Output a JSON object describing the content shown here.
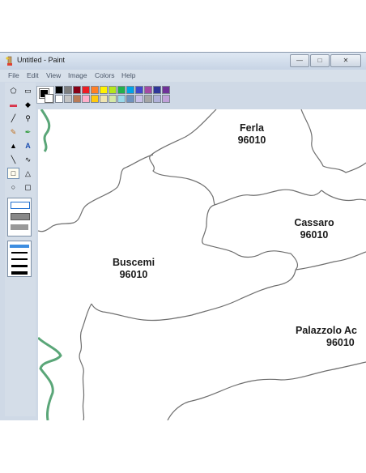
{
  "window": {
    "title": "Untitled - Paint",
    "min": "—",
    "max": "□",
    "close": "✕"
  },
  "menu": [
    "File",
    "Edit",
    "View",
    "Image",
    "Colors",
    "Help"
  ],
  "tools": [
    {
      "name": "free-form-select-icon",
      "glyph": "⬠"
    },
    {
      "name": "rect-select-icon",
      "glyph": "▭"
    },
    {
      "name": "eraser-icon",
      "glyph": "▬"
    },
    {
      "name": "fill-bucket-icon",
      "glyph": "◆"
    },
    {
      "name": "color-picker-icon",
      "glyph": "╱"
    },
    {
      "name": "magnifier-icon",
      "glyph": "⚲"
    },
    {
      "name": "pencil-icon",
      "glyph": "✎"
    },
    {
      "name": "brush-icon",
      "glyph": "✒"
    },
    {
      "name": "airbrush-icon",
      "glyph": "▲"
    },
    {
      "name": "text-tool-icon",
      "glyph": "A"
    },
    {
      "name": "line-tool-icon",
      "glyph": "╲"
    },
    {
      "name": "curve-tool-icon",
      "glyph": "∿"
    },
    {
      "name": "rectangle-tool-icon",
      "glyph": "□"
    },
    {
      "name": "polygon-tool-icon",
      "glyph": "△"
    },
    {
      "name": "ellipse-tool-icon",
      "glyph": "○"
    },
    {
      "name": "rounded-rect-tool-icon",
      "glyph": "▢"
    }
  ],
  "palette": {
    "row1": [
      "#000000",
      "#7f7f7f",
      "#880015",
      "#ed1c24",
      "#ff7f27",
      "#fff200",
      "#b5e61d",
      "#22b14c",
      "#00a2e8",
      "#3f48cc",
      "#a349a4",
      "#2f3699",
      "#6f3198"
    ],
    "row2": [
      "#ffffff",
      "#c3c3c3",
      "#b97a57",
      "#ffaec9",
      "#ffc90e",
      "#efe4b0",
      "#d5e8a6",
      "#99d9ea",
      "#7092be",
      "#c8bfe7",
      "#a5a5a5",
      "#b0b0d8",
      "#c0a0d8"
    ]
  },
  "map": {
    "towns": [
      {
        "name": "Ferla",
        "code": "96010"
      },
      {
        "name": "Cassaro",
        "code": "96010"
      },
      {
        "name": "Buscemi",
        "code": "96010"
      },
      {
        "name": "Palazzolo Ac",
        "code": "96010"
      }
    ],
    "coast_color": "#5aa678"
  }
}
